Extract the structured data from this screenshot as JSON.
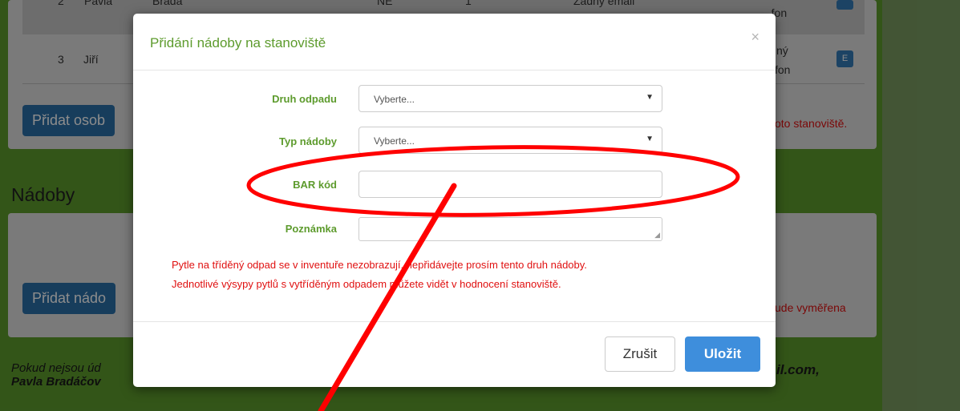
{
  "background": {
    "rows": [
      {
        "num": "2",
        "name": "Pavla",
        "surname": "Bradá",
        "col3": "NE",
        "col4": "1",
        "col5": "Žádný email",
        "contact": "...fon"
      },
      {
        "num": "3",
        "name": "Jiří",
        "contact_top": "ný",
        "contact_bottom": "fon",
        "badge": "E"
      }
    ],
    "add_person_label": "Přidat osob",
    "station_warning_tail": "oto stanoviště.",
    "section_heading": "Nádoby",
    "add_container_label": "Přidat nádo",
    "measure_tail": "ude vyměřena",
    "footer_note_line1": "Pokud nejsou úd",
    "footer_note_email_tail": "il.com,",
    "footer_note_line2": "Pavla Bradáčov"
  },
  "modal": {
    "title": "Přidání nádoby na stanoviště",
    "close_glyph": "×",
    "fields": {
      "waste_type": {
        "label": "Druh odpadu",
        "value": "Vyberte..."
      },
      "container_type": {
        "label": "Typ nádoby",
        "value": "Vyberte..."
      },
      "barcode": {
        "label": "BAR kód",
        "value": ""
      },
      "note": {
        "label": "Poznámka",
        "value": ""
      }
    },
    "warning_line1": "Pytle na tříděný odpad se v inventuře nezobrazují, nepřidávejte prosím tento druh nádoby.",
    "warning_line2": "Jednotlivé výsypy pytlů s vytříděným odpadem můžete vidět v hodnocení stanoviště.",
    "cancel_label": "Zrušit",
    "save_label": "Uložit"
  },
  "colors": {
    "accent_green": "#5d9b2d",
    "warning_red": "#e01010",
    "primary_blue": "#3e8edc",
    "annotation_red": "#ff0000"
  }
}
